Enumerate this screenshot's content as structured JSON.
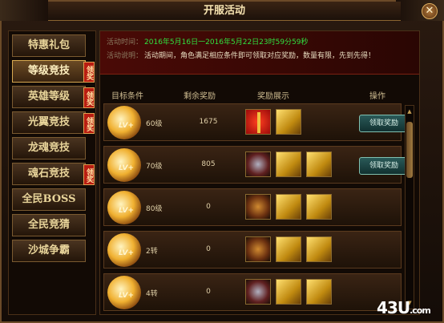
{
  "window": {
    "title": "开服活动"
  },
  "sidebar": {
    "items": [
      {
        "label": "特惠礼包",
        "active": false,
        "badge": ""
      },
      {
        "label": "等级竞技",
        "active": true,
        "badge": "领奖"
      },
      {
        "label": "英雄等级",
        "active": false,
        "badge": "领奖"
      },
      {
        "label": "光翼竞技",
        "active": false,
        "badge": "领奖"
      },
      {
        "label": "龙魂竞技",
        "active": false,
        "badge": ""
      },
      {
        "label": "魂石竞技",
        "active": false,
        "badge": "领奖"
      },
      {
        "label": "全民BOSS",
        "active": false,
        "badge": ""
      },
      {
        "label": "全民竞猜",
        "active": false,
        "badge": ""
      },
      {
        "label": "沙城争霸",
        "active": false,
        "badge": ""
      }
    ]
  },
  "info": {
    "time_label": "活动时间：",
    "time_value": "2016年5月16日一2016年5月22日23时59分59秒",
    "desc_label": "活动说明：",
    "desc_value": "活动期间，角色满足相应条件即可领取对应奖励，数量有限，先到先得！"
  },
  "table": {
    "headers": [
      "目标条件",
      "剩余奖励",
      "奖励展示",
      "操作"
    ],
    "rows": [
      {
        "lv_badge": "LV+",
        "condition": "60级",
        "remaining": "1675",
        "rewards": [
          "gift",
          "ticket"
        ],
        "action": "领取奖励"
      },
      {
        "lv_badge": "LV+",
        "condition": "70级",
        "remaining": "805",
        "rewards": [
          "armor",
          "ticket",
          "ticket"
        ],
        "action": "领取奖励"
      },
      {
        "lv_badge": "LV+",
        "condition": "80级",
        "remaining": "0",
        "rewards": [
          "wing",
          "ticket",
          "ticket"
        ],
        "action": ""
      },
      {
        "lv_badge": "LV+",
        "condition": "2转",
        "remaining": "0",
        "rewards": [
          "wing",
          "ticket",
          "ticket"
        ],
        "action": ""
      },
      {
        "lv_badge": "LV+",
        "condition": "4转",
        "remaining": "0",
        "rewards": [
          "armor",
          "ticket",
          "ticket"
        ],
        "action": ""
      }
    ]
  },
  "watermark": {
    "main": "43U",
    "sub": ".com"
  }
}
